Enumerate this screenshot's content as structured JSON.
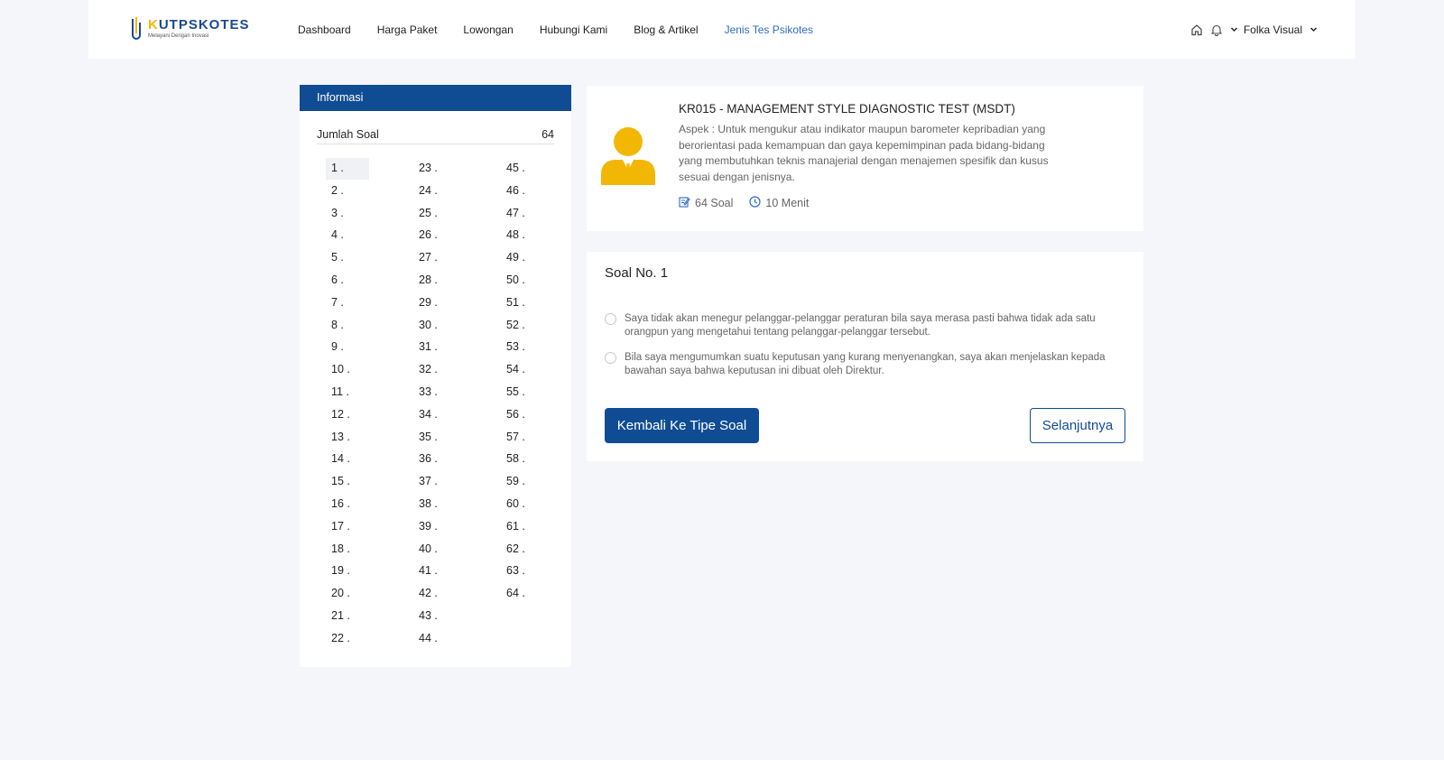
{
  "header": {
    "logo_name_k": "K",
    "logo_name_rest": "UTPSKOTES",
    "logo_tagline": "Melayani Dengan Inovasi",
    "nav": [
      {
        "label": "Dashboard"
      },
      {
        "label": "Harga Paket"
      },
      {
        "label": "Lowongan"
      },
      {
        "label": "Hubungi Kami"
      },
      {
        "label": "Blog & Artikel"
      },
      {
        "label": "Jenis Tes Psikotes"
      }
    ],
    "active_nav": "Jenis Tes Psikotes",
    "user_name": "Folka Visual",
    "icons": [
      "home-icon",
      "bell-icon",
      "chevron-down-icon"
    ]
  },
  "sidebar": {
    "title": "Informasi",
    "count_label": "Jumlah Soal",
    "count_value": "64",
    "current_question": "1",
    "questions": [
      "1 .",
      "2 .",
      "3 .",
      "4 .",
      "5 .",
      "6 .",
      "7 .",
      "8 .",
      "9 .",
      "10 .",
      "11 .",
      "12 .",
      "13 .",
      "14 .",
      "15 .",
      "16 .",
      "17 .",
      "18 .",
      "19 .",
      "20 .",
      "21 .",
      "22 .",
      "23 .",
      "24 .",
      "25 .",
      "26 .",
      "27 .",
      "28 .",
      "29 .",
      "30 .",
      "31 .",
      "32 .",
      "33 .",
      "34 .",
      "35 .",
      "36 .",
      "37 .",
      "38 .",
      "39 .",
      "40 .",
      "41 .",
      "42 .",
      "43 .",
      "44 .",
      "45 .",
      "46 .",
      "47 .",
      "48 .",
      "49 .",
      "50 .",
      "51 .",
      "52 .",
      "53 .",
      "54 .",
      "55 .",
      "56 .",
      "57 .",
      "58 .",
      "59 .",
      "60 .",
      "61 .",
      "62 .",
      "63 .",
      "64 ."
    ]
  },
  "test": {
    "title": "KR015 - MANAGEMENT STYLE DIAGNOSTIC TEST (MSDT)",
    "description": "Aspek : Untuk mengukur atau indikator maupun barometer kepribadian yang berorientasi pada kemampuan dan gaya kepemimpinan pada bidang-bidang yang membutuhkan teknis manajerial dengan menajemen spesifik dan kusus sesuai dengan jenisnya.",
    "question_count": "64 Soal",
    "duration": "10 Menit"
  },
  "question": {
    "title": "Soal No. 1",
    "options": [
      {
        "text": "Saya tidak akan menegur pelanggar-pelanggar peraturan bila saya merasa pasti bahwa tidak ada satu orangpun yang mengetahui tentang pelanggar-pelanggar tersebut."
      },
      {
        "text": "Bila saya mengumumkan suatu keputusan yang kurang menyenangkan, saya akan menjelaskan kepada bawahan saya bahwa keputusan ini dibuat oleh Direktur."
      }
    ],
    "back_label": "Kembali Ke Tipe Soal",
    "next_label": "Selanjutnya"
  },
  "colors": {
    "primary": "#0f4c94",
    "active_nav": "#2d6cc0",
    "accent_yellow": "#f2b705",
    "background": "#f5f6fa"
  }
}
